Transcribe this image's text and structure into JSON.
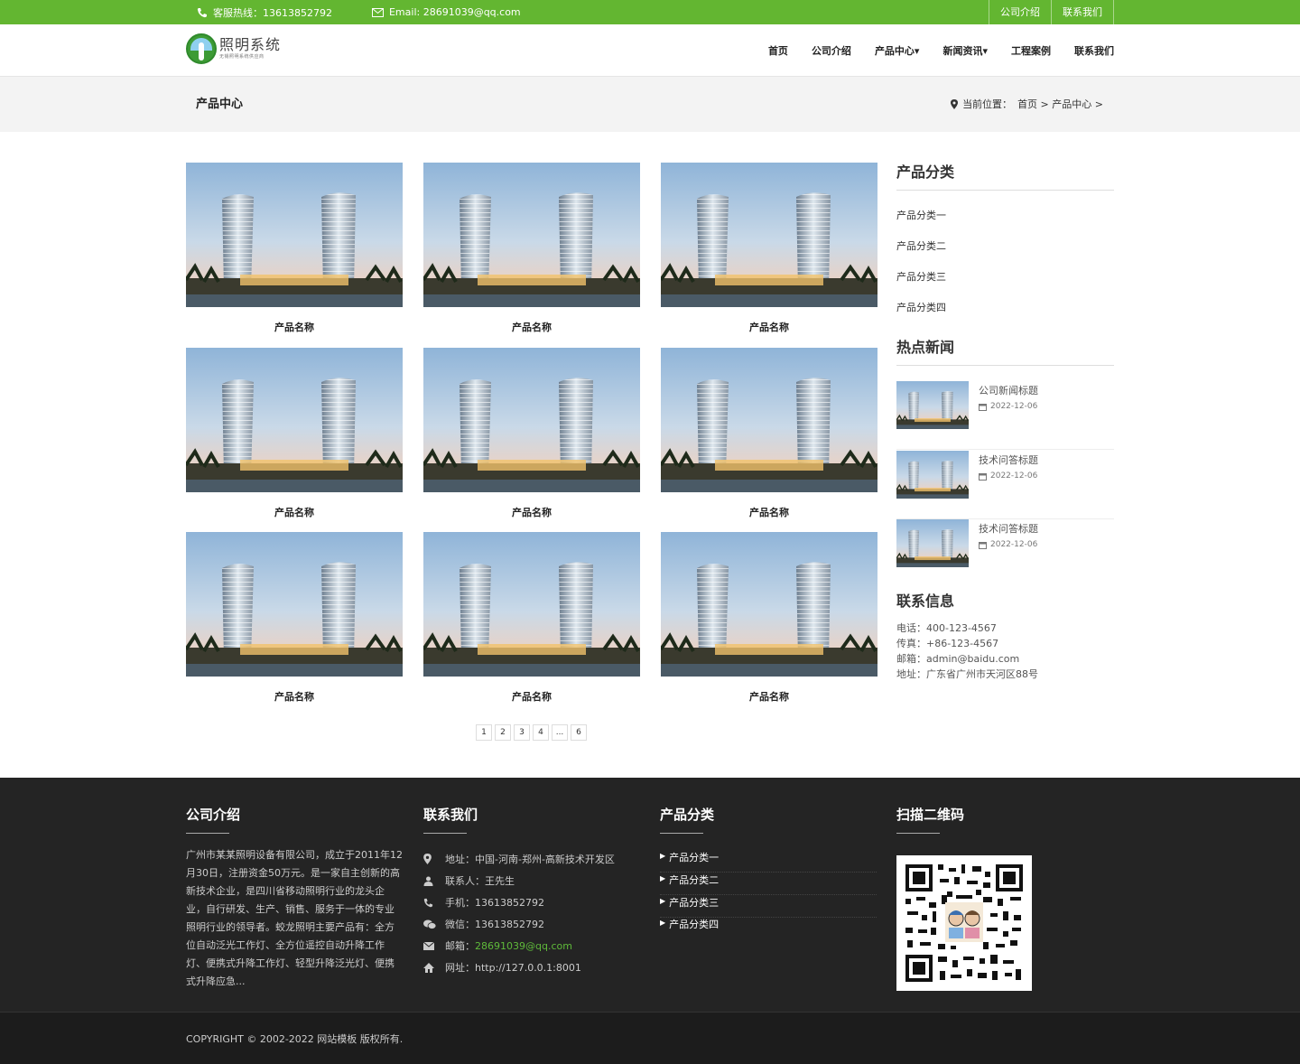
{
  "topbar": {
    "hotline": "客服热线：13613852792",
    "email": "Email: 28691039@qq.com",
    "links": [
      "公司介绍",
      "联系我们"
    ]
  },
  "logo": {
    "title": "照明系统",
    "subtitle": "无锡照明系统供应商"
  },
  "nav": [
    "首页",
    "公司介绍",
    "产品中心▾",
    "新闻资讯▾",
    "工程案例",
    "联系我们"
  ],
  "banner": {
    "title": "产品中心",
    "breadcrumb_label": "当前位置：",
    "breadcrumb_path": "首页 > 产品中心 >"
  },
  "products": [
    {
      "name": "产品名称"
    },
    {
      "name": "产品名称"
    },
    {
      "name": "产品名称"
    },
    {
      "name": "产品名称"
    },
    {
      "name": "产品名称"
    },
    {
      "name": "产品名称"
    },
    {
      "name": "产品名称"
    },
    {
      "name": "产品名称"
    },
    {
      "name": "产品名称"
    }
  ],
  "pagination": [
    "1",
    "2",
    "3",
    "4",
    "...",
    "6"
  ],
  "sidebar": {
    "categories_title": "产品分类",
    "categories": [
      "产品分类一",
      "产品分类二",
      "产品分类三",
      "产品分类四"
    ],
    "news_title": "热点新闻",
    "news": [
      {
        "title": "公司新闻标题",
        "date": "2022-12-06"
      },
      {
        "title": "技术问答标题",
        "date": "2022-12-06"
      },
      {
        "title": "技术问答标题",
        "date": "2022-12-06"
      }
    ],
    "contact_title": "联系信息",
    "contact": [
      "电话：400-123-4567",
      "传真：+86-123-4567",
      "邮箱：admin@baidu.com",
      "地址：广东省广州市天河区88号"
    ]
  },
  "footer": {
    "about_title": "公司介绍",
    "about_text": "广州市某某照明设备有限公司，成立于2011年12月30日，注册资金50万元。是一家自主创新的高新技术企业，是四川省移动照明行业的龙头企业，自行研发、生产、销售、服务于一体的专业照明行业的领导者。蛟龙照明主要产品有：全方位自动泛光工作灯、全方位遥控自动升降工作灯、便携式升降工作灯、轻型升降泛光灯、便携式升降应急...",
    "contact_title": "联系我们",
    "contact_items": [
      {
        "icon": "map-marker-icon",
        "text": "地址：中国-河南-郑州-高新技术开发区"
      },
      {
        "icon": "user-icon",
        "text": "联系人：王先生"
      },
      {
        "icon": "phone-icon",
        "text": "手机：13613852792"
      },
      {
        "icon": "wechat-icon",
        "text": "微信：13613852792"
      },
      {
        "icon": "envelope-icon",
        "label": "邮箱：",
        "value": "28691039@qq.com"
      },
      {
        "icon": "home-icon",
        "text": "网址：http://127.0.0.1:8001"
      }
    ],
    "categories_title": "产品分类",
    "categories": [
      "产品分类一",
      "产品分类二",
      "产品分类三",
      "产品分类四"
    ],
    "qr_title": "扫描二维码",
    "copyright": "COPYRIGHT © 2002-2022 网站模板 版权所有."
  },
  "colors": {
    "brand": "#63b631",
    "footer_bg": "#242424",
    "link_green": "#5fba3a"
  }
}
